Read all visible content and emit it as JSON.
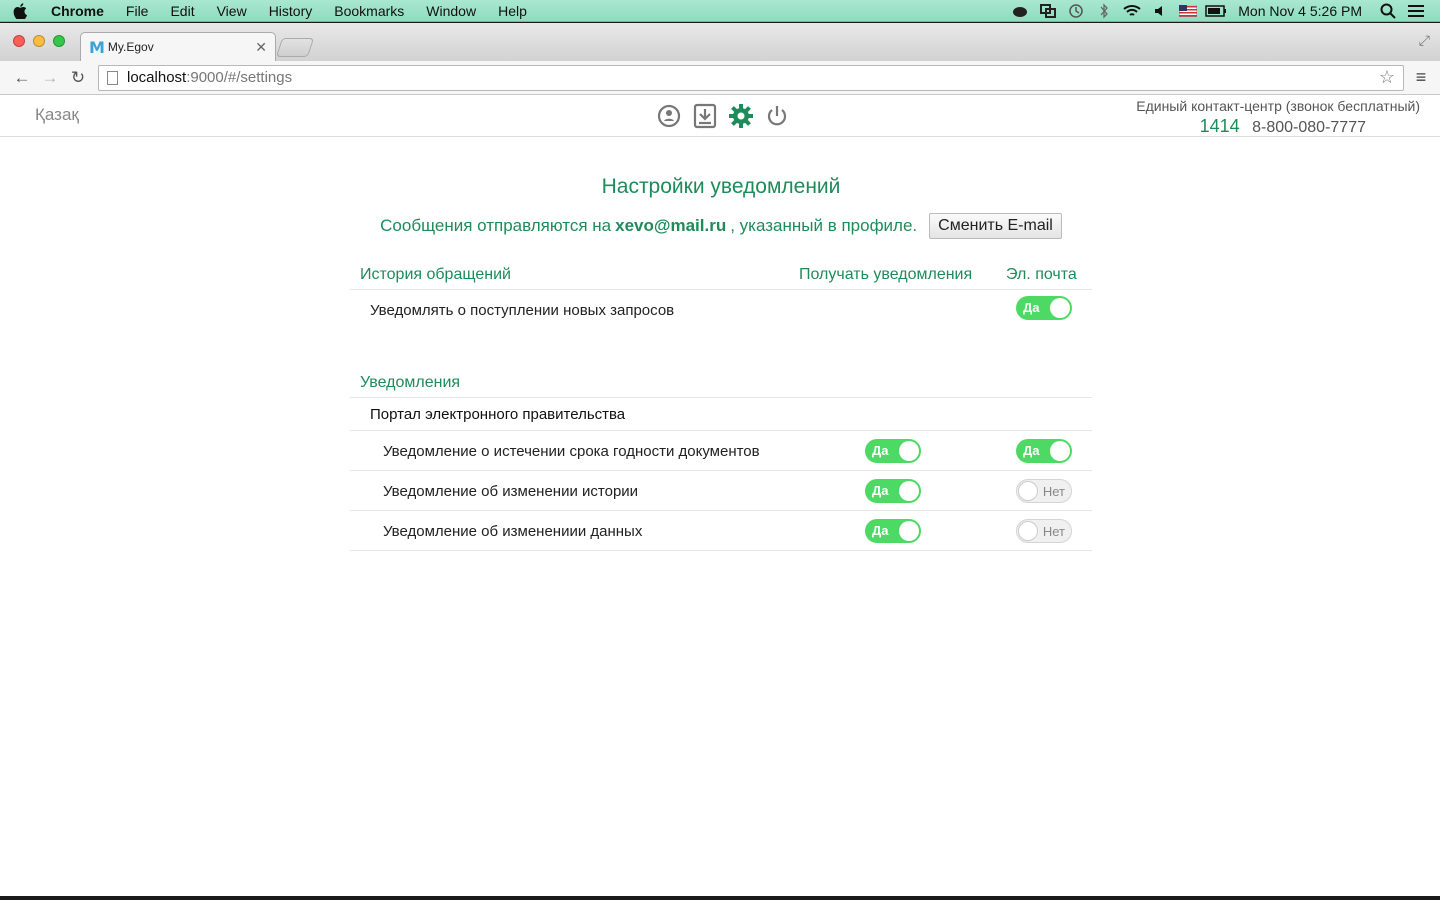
{
  "menubar": {
    "app_name": "Chrome",
    "items": [
      "File",
      "Edit",
      "View",
      "History",
      "Bookmarks",
      "Window",
      "Help"
    ],
    "clock": "Mon Nov 4  5:26 PM",
    "tray_icons": [
      "evernote-icon",
      "screen-icon",
      "time-machine-icon",
      "bluetooth-icon",
      "wifi-icon",
      "volume-icon",
      "flag-us-icon",
      "battery-icon"
    ]
  },
  "browser": {
    "tab_title": "My.Egov",
    "favicon_letter": "M",
    "url_host": "localhost",
    "url_path": ":9000/#/settings"
  },
  "header": {
    "lang": "Қазақ",
    "contact_label": "Единый контакт-центр (звонок бесплатный)",
    "short_number": "1414",
    "long_number": "8-800-080-7777"
  },
  "settings": {
    "title": "Настройки уведомлений",
    "email_prefix": "Сообщения отправляются на",
    "email": "xevo@mail.ru",
    "email_suffix": ", указанный в профиле.",
    "change_email_label": "Сменить E-mail",
    "history_section": {
      "label": "История обращений",
      "col_receive": "Получать уведомления",
      "col_email": "Эл. почта",
      "rows": [
        {
          "label": "Уведомлять о поступлении новых запросов",
          "email": "Да"
        }
      ]
    },
    "notifications_section": {
      "label": "Уведомления",
      "group": "Портал электронного правительства",
      "rows": [
        {
          "label": "Уведомление о истечении срока годности документов",
          "receive": "Да",
          "email": "Да"
        },
        {
          "label": "Уведомление об изменении истории",
          "receive": "Да",
          "email": "Нет"
        },
        {
          "label": "Уведомление об изменениии данных",
          "receive": "Да",
          "email": "Нет"
        }
      ]
    }
  },
  "colors": {
    "brand_green": "#1e8c5a",
    "toggle_on": "#4cd964",
    "menubar": "#a9e7d1"
  }
}
